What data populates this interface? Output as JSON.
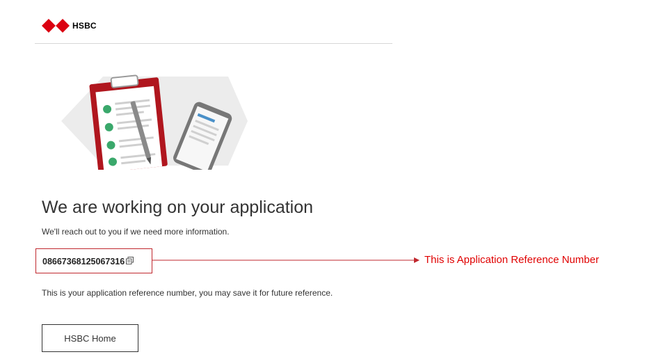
{
  "brand": {
    "name": "HSBC",
    "color": "#db0011"
  },
  "page": {
    "title": "We are working on your application",
    "subtitle": "We'll reach out to you if we need more information.",
    "reference_number": "08667368125067316",
    "reference_note": "This is your application reference number, you may save it for future reference.",
    "home_button_label": "HSBC Home"
  },
  "annotation": {
    "text": "This is Application Reference Number",
    "color": "#e00000"
  },
  "icons": {
    "copy": "copy-icon",
    "hero": "clipboard-phone-illustration"
  }
}
